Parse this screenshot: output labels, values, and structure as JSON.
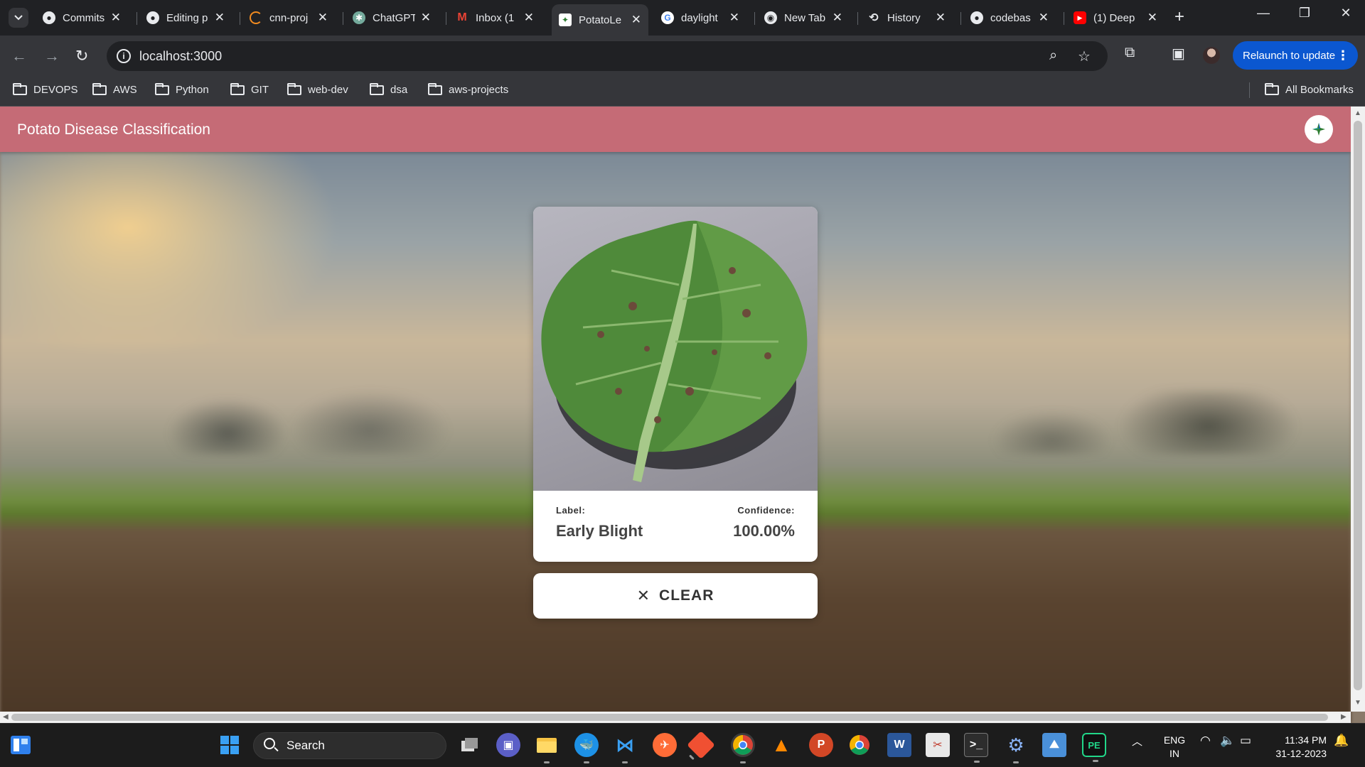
{
  "browser": {
    "tabs": [
      {
        "title": "Commits",
        "icon": "github-icon",
        "active": false
      },
      {
        "title": "Editing p",
        "icon": "github-icon",
        "active": false
      },
      {
        "title": "cnn-proj",
        "icon": "loading-icon",
        "active": false
      },
      {
        "title": "ChatGPT",
        "icon": "chatgpt-icon",
        "active": false
      },
      {
        "title": "Inbox (1",
        "icon": "gmail-icon",
        "active": false
      },
      {
        "title": "PotatoLe",
        "icon": "potato-app-icon",
        "active": true
      },
      {
        "title": "daylight",
        "icon": "google-icon",
        "active": false
      },
      {
        "title": "New Tab",
        "icon": "chrome-icon",
        "active": false
      },
      {
        "title": "History",
        "icon": "history-icon",
        "active": false
      },
      {
        "title": "codebas",
        "icon": "github-icon",
        "active": false
      },
      {
        "title": "(1) Deep",
        "icon": "youtube-icon",
        "active": false
      }
    ],
    "url": "localhost:3000",
    "relaunch_label": "Relaunch to update",
    "bookmarks": [
      "DEVOPS",
      "AWS",
      "Python",
      "GIT",
      "web-dev",
      "dsa",
      "aws-projects"
    ],
    "all_bookmarks_label": "All Bookmarks"
  },
  "app": {
    "title": "Potato Disease Classification",
    "accent_color": "#c56b76",
    "result": {
      "label_heading": "Label:",
      "label_value": "Early Blight",
      "confidence_heading": "Confidence:",
      "confidence_value": "100.00%"
    },
    "clear_label": "CLEAR"
  },
  "taskbar": {
    "search_placeholder": "Search",
    "language": "ENG",
    "region": "IN",
    "time": "11:34 PM",
    "date": "31-12-2023"
  }
}
